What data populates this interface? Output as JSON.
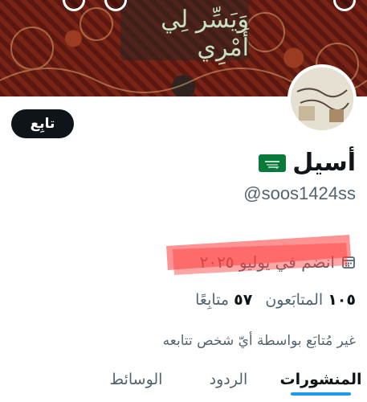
{
  "banner": {
    "calligraphy": "وَيَسِّر لِي أَمْرِي"
  },
  "profile": {
    "name": "أسيل",
    "flag_icon": "saudi-flag",
    "handle": "@soos1424ss",
    "follow_label": "تابِع",
    "join_text": "انضم في يوليو ٢٠٢٥",
    "followers_count": "١٠٥",
    "followers_label": "المتابَعون",
    "following_count": "٥٧",
    "following_label": "متابِعًا",
    "notice": "غير مُتابَع بواسطة أيّ شخص تتابعه"
  },
  "tabs": [
    {
      "label": "المنشورات",
      "active": true
    },
    {
      "label": "الردود",
      "active": false
    },
    {
      "label": "الوسائط",
      "active": false
    }
  ],
  "colors": {
    "accent": "#1d9bf0",
    "banner": "#6b1c12",
    "annotation": "#ff3b3b"
  }
}
